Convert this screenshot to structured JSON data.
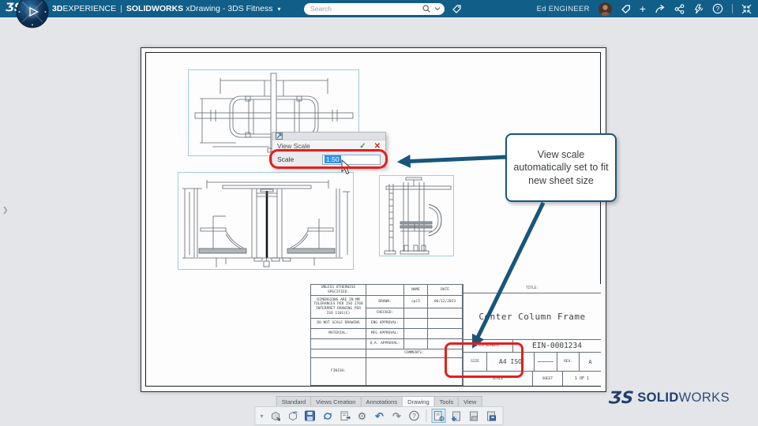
{
  "topbar": {
    "brand": {
      "bold": "3D",
      "light": "EXPERIENCE",
      "sep": "|",
      "app": "SOLIDWORKS",
      "context": "xDrawing - 3DS Fitness"
    },
    "search_placeholder": "Search",
    "user_name": "Ed ENGINEER"
  },
  "dialog": {
    "title": "View Scale",
    "scale_label": "Scale",
    "scale_value": "1:50"
  },
  "callout_text": "View scale automatically set to fit new sheet size",
  "title_block": {
    "unless": "UNLESS OTHERWISE SPECIFIED:",
    "dims": "DIMENSIONS ARE IN MM TOLERANCES PER ISO 2768 INTERPRET DRAWING PER ISO 1101(E)",
    "no_scale": "DO NOT SCALE DRAWING",
    "material": "MATERIAL:",
    "finish": "FINISH:",
    "name_h": "NAME",
    "date_h": "DATE",
    "drawn": "DRAWN:",
    "drawn_name": "cpi5",
    "drawn_date": "06/12/2023",
    "checked": "CHECKED:",
    "eng": "ENG APPROVAL:",
    "mfg": "MFG APPROVAL:",
    "qa": "Q.A. APPROVAL:",
    "comments": "COMMENTS:",
    "title_label": "TITLE:",
    "title_value": "Center Column Frame",
    "item_label": "ITEM NUMBER:",
    "item_value": "EIN-0001234",
    "size_label": "SIZE",
    "size_value": "A4 ISO",
    "rev_label": "REV.",
    "rev_value": "A",
    "scale_label": "SCALE",
    "sheet_label": "SHEET",
    "sheet_value": "1 OF 1"
  },
  "ribbon_tabs": [
    {
      "label": "Standard"
    },
    {
      "label": "Views Creation"
    },
    {
      "label": "Annotations"
    },
    {
      "label": "Drawing",
      "active": true
    },
    {
      "label": "Tools"
    },
    {
      "label": "View"
    }
  ],
  "toolbar_icons": [
    "export-model",
    "import-model",
    "save",
    "reload",
    "page-setup",
    "settings",
    "undo",
    "redo",
    "help",
    "sheet-properties",
    "add-sheet",
    "sheet-format",
    "save-sheet-format"
  ],
  "toolbar_active_icon": "sheet-properties",
  "logo": {
    "glyph": "ƷS",
    "bold": "SOLID",
    "light": "WORKS"
  },
  "colors": {
    "topbar": "#115e88",
    "accent": "#19567a",
    "annotation_red": "#e3201c",
    "selection_blue": "#2f8fe8"
  }
}
